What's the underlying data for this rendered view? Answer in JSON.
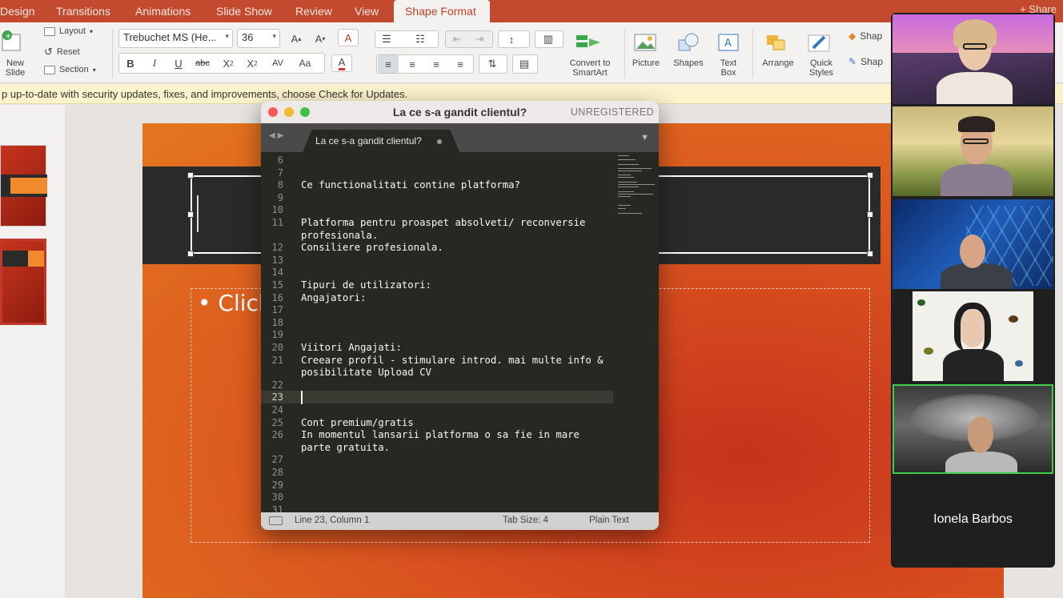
{
  "ribbon": {
    "tabs": [
      "Design",
      "Transitions",
      "Animations",
      "Slide Show",
      "Review",
      "View",
      "Shape Format"
    ],
    "share_label": "Share",
    "new_slide_label": "New\nSlide",
    "layout_label": "Layout",
    "reset_label": "Reset",
    "section_label": "Section",
    "font_name": "Trebuchet MS (He...",
    "font_size": "36",
    "convert_label": "Convert to\nSmartArt",
    "picture_label": "Picture",
    "shapes_label": "Shapes",
    "textbox_label": "Text\nBox",
    "arrange_label": "Arrange",
    "quick_styles_label": "Quick\nStyles",
    "shape_fill_label": "Shap",
    "shape_outline_label": "Shap"
  },
  "message_bar": "p up-to-date with security updates, fixes, and improvements, choose Check for Updates.",
  "slide": {
    "placeholder_bullet": "• Click"
  },
  "editor": {
    "title": "La ce s-a gandit clientul?",
    "unregistered": "UNREGISTERED",
    "tab_label": "La ce s-a gandit clientul?",
    "lines": [
      {
        "n": "6",
        "t": ""
      },
      {
        "n": "7",
        "t": ""
      },
      {
        "n": "8",
        "t": "Ce functionalitati contine platforma?"
      },
      {
        "n": "9",
        "t": ""
      },
      {
        "n": "10",
        "t": ""
      },
      {
        "n": "11",
        "t": "Platforma pentru proaspet absolveti/ reconversie"
      },
      {
        "n": "",
        "t": "profesionala."
      },
      {
        "n": "12",
        "t": "Consiliere profesionala."
      },
      {
        "n": "13",
        "t": ""
      },
      {
        "n": "14",
        "t": ""
      },
      {
        "n": "15",
        "t": "Tipuri de utilizatori:"
      },
      {
        "n": "16",
        "t": "Angajatori:"
      },
      {
        "n": "17",
        "t": ""
      },
      {
        "n": "18",
        "t": ""
      },
      {
        "n": "19",
        "t": ""
      },
      {
        "n": "20",
        "t": "Viitori Angajati:"
      },
      {
        "n": "21",
        "t": "Creeare profil - stimulare introd. mai multe info &"
      },
      {
        "n": "",
        "t": "posibilitate Upload CV"
      },
      {
        "n": "22",
        "t": ""
      },
      {
        "n": "23",
        "t": ""
      },
      {
        "n": "24",
        "t": ""
      },
      {
        "n": "25",
        "t": "Cont premium/gratis"
      },
      {
        "n": "26",
        "t": "In momentul lansarii platforma o sa fie in mare"
      },
      {
        "n": "",
        "t": "parte gratuita."
      },
      {
        "n": "27",
        "t": ""
      },
      {
        "n": "28",
        "t": ""
      },
      {
        "n": "29",
        "t": ""
      },
      {
        "n": "30",
        "t": ""
      },
      {
        "n": "31",
        "t": ""
      }
    ],
    "current_line": "23",
    "status_position": "Line 23, Column 1",
    "status_tabsize": "Tab Size: 4",
    "status_syntax": "Plain Text"
  },
  "participants": {
    "name_only": "Ionela Barbos"
  },
  "colors": {
    "accent": "#c44a2f",
    "active_speaker": "#3fcf4d",
    "editor_bg": "#272822"
  }
}
